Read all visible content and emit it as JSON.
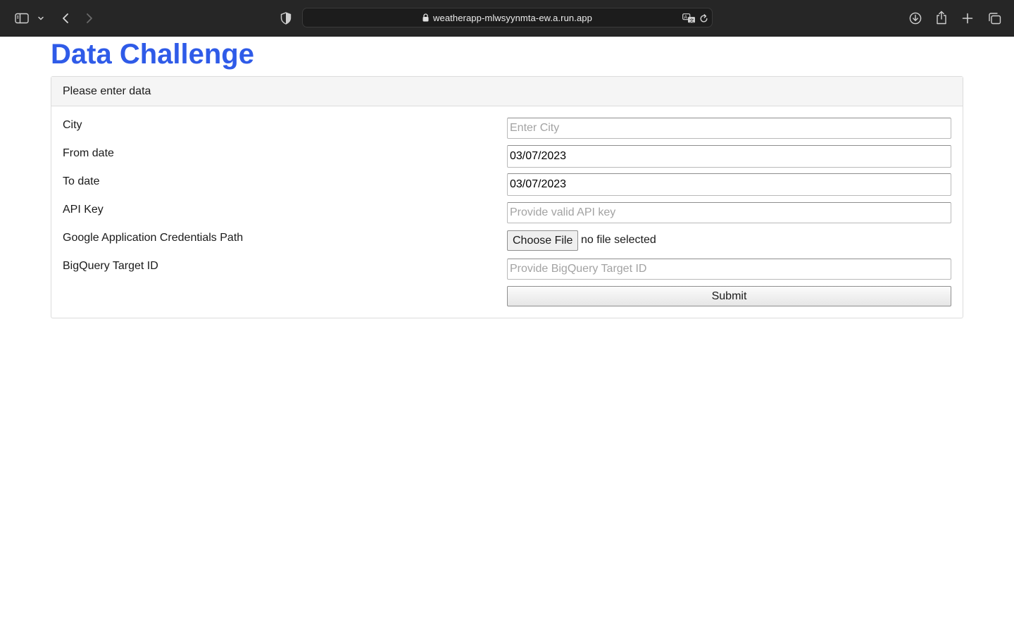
{
  "browser": {
    "url": "weatherapp-mlwsyynmta-ew.a.run.app"
  },
  "page": {
    "title": "Data Challenge",
    "card_header": "Please enter data"
  },
  "form": {
    "city": {
      "label": "City",
      "placeholder": "Enter City",
      "value": ""
    },
    "from_date": {
      "label": "From date",
      "value": "03/07/2023"
    },
    "to_date": {
      "label": "To date",
      "value": "03/07/2023"
    },
    "api_key": {
      "label": "API Key",
      "placeholder": "Provide valid API key",
      "value": ""
    },
    "credentials": {
      "label": "Google Application Credentials Path",
      "button": "Choose File",
      "status": "no file selected"
    },
    "bigquery": {
      "label": "BigQuery Target ID",
      "placeholder": "Provide BigQuery Target ID",
      "value": ""
    },
    "submit": "Submit"
  }
}
